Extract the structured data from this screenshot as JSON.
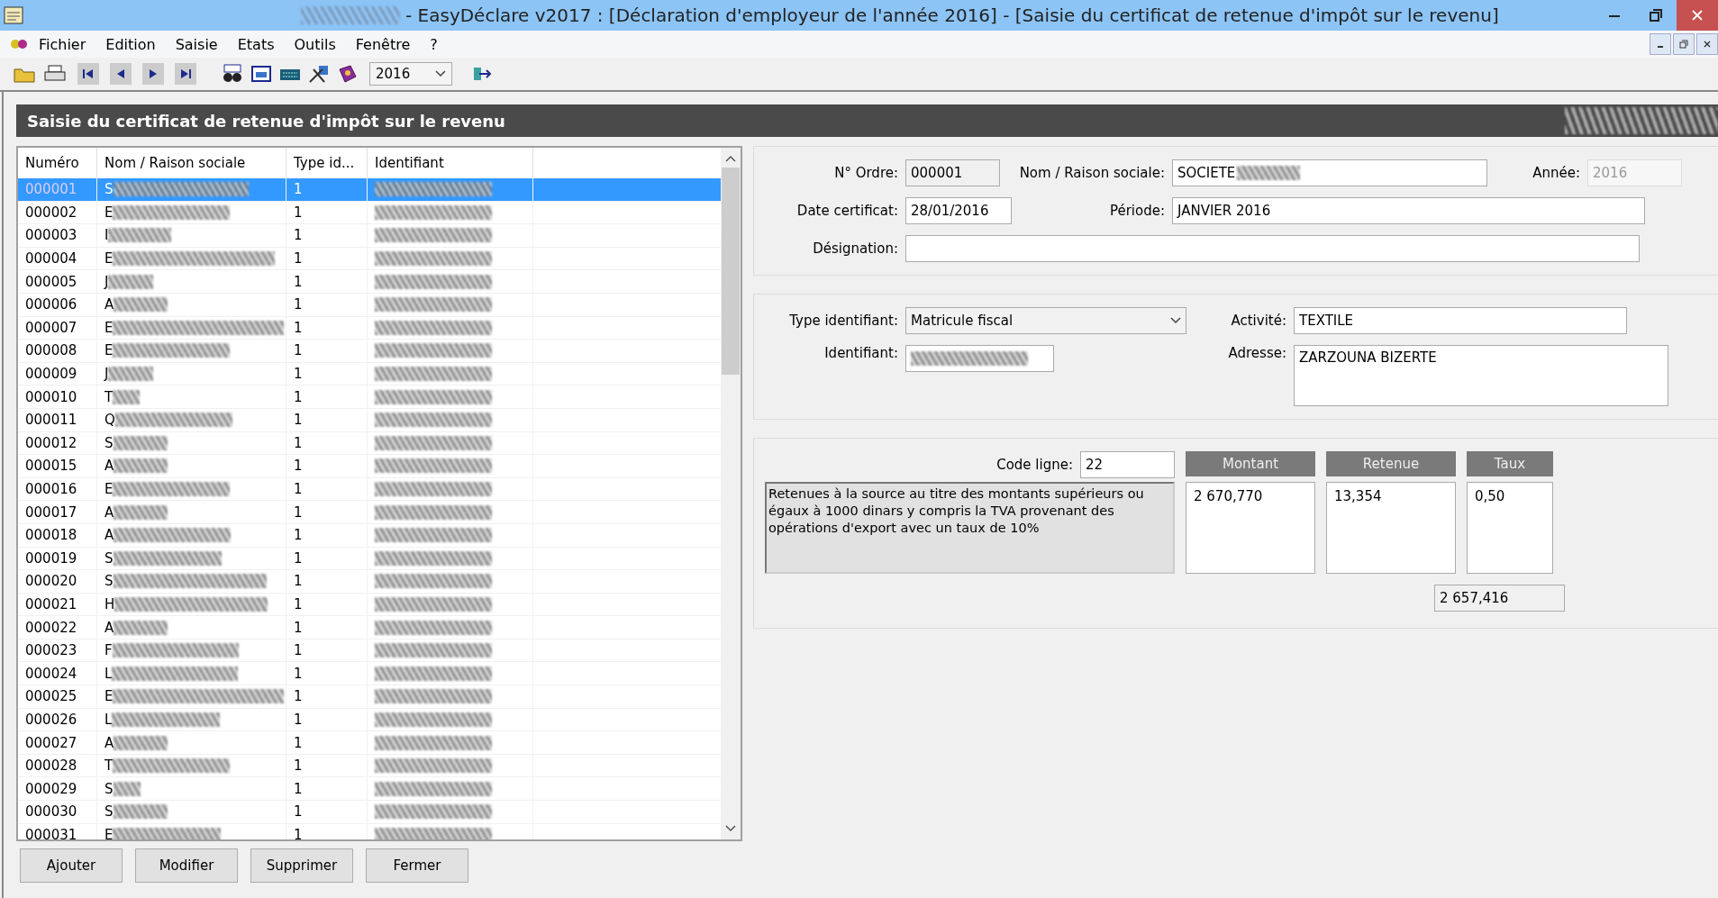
{
  "window": {
    "title": "- EasyDéclare v2017  : [Déclaration d'employeur de l'année 2016] - [Saisie du certificat de retenue d'impôt sur le revenu]"
  },
  "menu": [
    "Fichier",
    "Edition",
    "Saisie",
    "Etats",
    "Outils",
    "Fenêtre",
    "?"
  ],
  "toolbar": {
    "year": "2016"
  },
  "form_title": "Saisie du certificat de retenue d'impôt sur le revenu",
  "table": {
    "columns": [
      "Numéro",
      "Nom / Raison sociale",
      "Type id...",
      "Identifiant"
    ],
    "rows": [
      {
        "numero": "000001",
        "name": "S",
        "type": "1",
        "selected": true
      },
      {
        "numero": "000002",
        "name": "E",
        "type": "1",
        "selected": false
      },
      {
        "numero": "000003",
        "name": "I",
        "type": "1",
        "selected": false
      },
      {
        "numero": "000004",
        "name": "E",
        "type": "1",
        "selected": false
      },
      {
        "numero": "000005",
        "name": "J",
        "type": "1",
        "selected": false
      },
      {
        "numero": "000006",
        "name": "A",
        "type": "1",
        "selected": false
      },
      {
        "numero": "000007",
        "name": "E",
        "type": "1",
        "selected": false
      },
      {
        "numero": "000008",
        "name": "E",
        "type": "1",
        "selected": false
      },
      {
        "numero": "000009",
        "name": "J",
        "type": "1",
        "selected": false
      },
      {
        "numero": "000010",
        "name": "T",
        "type": "1",
        "selected": false
      },
      {
        "numero": "000011",
        "name": "Q",
        "type": "1",
        "selected": false
      },
      {
        "numero": "000012",
        "name": "S",
        "type": "1",
        "selected": false
      },
      {
        "numero": "000015",
        "name": "A",
        "type": "1",
        "selected": false
      },
      {
        "numero": "000016",
        "name": "E",
        "type": "1",
        "selected": false
      },
      {
        "numero": "000017",
        "name": "A",
        "type": "1",
        "selected": false
      },
      {
        "numero": "000018",
        "name": "A",
        "type": "1",
        "selected": false
      },
      {
        "numero": "000019",
        "name": "S",
        "type": "1",
        "selected": false
      },
      {
        "numero": "000020",
        "name": "S",
        "type": "1",
        "selected": false
      },
      {
        "numero": "000021",
        "name": "H",
        "type": "1",
        "selected": false
      },
      {
        "numero": "000022",
        "name": "A",
        "type": "1",
        "selected": false
      },
      {
        "numero": "000023",
        "name": "F",
        "type": "1",
        "selected": false
      },
      {
        "numero": "000024",
        "name": "L",
        "type": "1",
        "selected": false
      },
      {
        "numero": "000025",
        "name": "E",
        "type": "1",
        "selected": false
      },
      {
        "numero": "000026",
        "name": "L",
        "type": "1",
        "selected": false
      },
      {
        "numero": "000027",
        "name": "A",
        "type": "1",
        "selected": false
      },
      {
        "numero": "000028",
        "name": "T",
        "type": "1",
        "selected": false
      },
      {
        "numero": "000029",
        "name": "S",
        "type": "1",
        "selected": false
      },
      {
        "numero": "000030",
        "name": "S",
        "type": "1",
        "selected": false
      },
      {
        "numero": "000031",
        "name": "E",
        "type": "1",
        "selected": false
      }
    ]
  },
  "buttons": [
    "Ajouter",
    "Modifier",
    "Supprimer",
    "Fermer"
  ],
  "form": {
    "ordre_label": "N° Ordre:",
    "ordre": "000001",
    "nom_label": "Nom / Raison sociale:",
    "nom": "SOCIETE",
    "annee_label": "Année:",
    "annee": "2016",
    "date_label": "Date certificat:",
    "date": "28/01/2016",
    "periode_label": "Période:",
    "periode": "JANVIER 2016",
    "designation_label": "Désignation:",
    "type_label": "Type identifiant:",
    "type": "Matricule fiscal",
    "activite_label": "Activité:",
    "activite": "TEXTILE",
    "identifiant_label": "Identifiant:",
    "adresse_label": "Adresse:",
    "adresse": "ZARZOUNA BIZERTE",
    "code_label": "Code ligne:",
    "code": "22",
    "description": "Retenues à la source au titre des montants supérieurs ou égaux à 1000 dinars y compris la TVA provenant des opérations d'export avec un taux de 10%",
    "amount_headers": [
      "Montant",
      "Retenue",
      "Taux"
    ],
    "amounts": [
      "2 670,770",
      "13,354",
      "0,50"
    ],
    "net": "2 657,416"
  }
}
